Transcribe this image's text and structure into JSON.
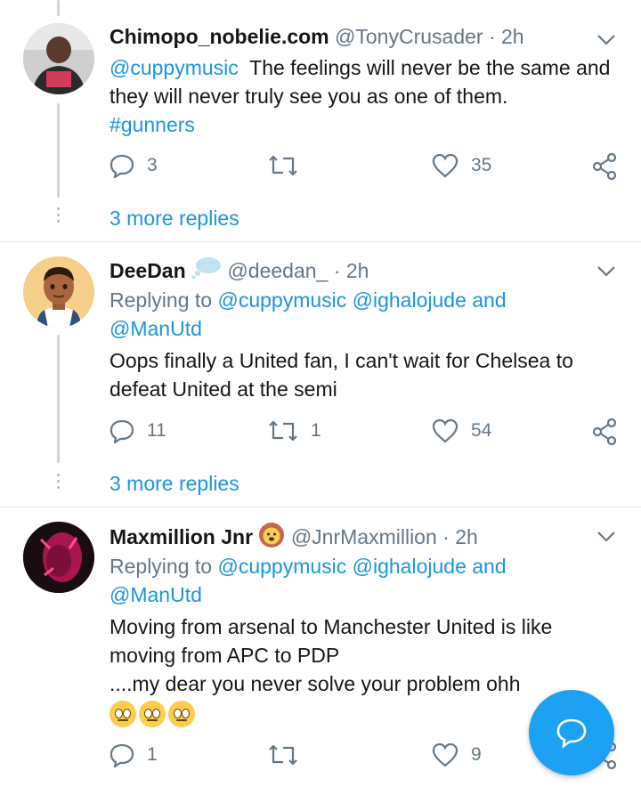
{
  "tweets": [
    {
      "name": "Chimopo_nobelie.com",
      "handle": "@TonyCrusader",
      "separator": "·",
      "time": "2h",
      "text_mention": "@cuppymusic",
      "text_body": "  The feelings will never be the same and they will never truly see you as one of them.",
      "hashtag": "#gunners",
      "replies": "3",
      "retweets": "",
      "likes": "35",
      "more_replies": "3 more replies"
    },
    {
      "name": "DeeDan",
      "handle": "@deedan_",
      "separator": "·",
      "time": "2h",
      "replying_prefix": "Replying to ",
      "replying_mentions": "@cuppymusic @ighalojude and",
      "replying_mentions2": "@ManUtd",
      "text": "Oops finally a United fan, I can't wait for Chelsea to defeat United at the semi",
      "replies": "11",
      "retweets": "1",
      "likes": "54",
      "more_replies": "3 more replies"
    },
    {
      "name": "Maxmillion Jnr",
      "handle": "@JnrMaxmillion",
      "separator": "·",
      "time": "2h",
      "replying_prefix": "Replying to ",
      "replying_mentions": "@cuppymusic @ighalojude and",
      "replying_mentions2": "@ManUtd",
      "text_line1": "Moving from arsenal to Manchester United is like",
      "text_line2": "moving from APC to PDP",
      "text_line3": "....my dear you never solve your problem ohh",
      "replies": "1",
      "retweets": "",
      "likes": "9"
    }
  ],
  "colors": {
    "link": "#1b95e0",
    "meta": "#657786",
    "fab": "#1da1f2"
  },
  "icons": [
    "reply-icon",
    "retweet-icon",
    "like-icon",
    "share-icon",
    "chevron-down-icon",
    "compose-icon"
  ]
}
